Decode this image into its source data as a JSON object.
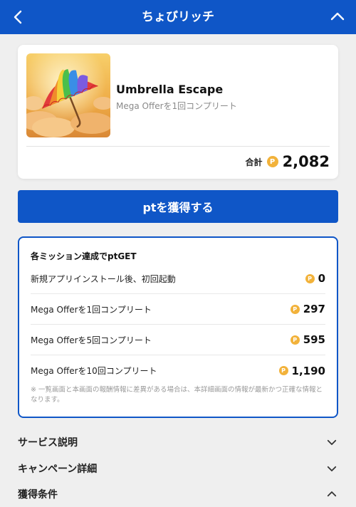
{
  "header": {
    "title": "ちょびリッチ",
    "back_icon": "chevron-left-icon",
    "collapse_icon": "chevron-up-icon"
  },
  "offer": {
    "name": "Umbrella Escape",
    "subtitle": "Mega Offerを1回コンプリート",
    "total_label": "合計",
    "total_value": "2,082"
  },
  "cta": {
    "label": "ptを獲得する"
  },
  "missions": {
    "title": "各ミッション達成でptGET",
    "items": [
      {
        "label": "新規アプリインストール後、初回起動",
        "points": "0"
      },
      {
        "label": "Mega Offerを1回コンプリート",
        "points": "297"
      },
      {
        "label": "Mega Offerを5回コンプリート",
        "points": "595"
      },
      {
        "label": "Mega Offerを10回コンプリート",
        "points": "1,190"
      }
    ],
    "note": "※ 一覧画面と本画面の報酬情報に差異がある場合は、本詳細画面の情報が最新かつ正確な情報となります。"
  },
  "sections": [
    {
      "label": "サービス説明",
      "icon": "chevron-down-icon"
    },
    {
      "label": "キャンペーン詳細",
      "icon": "chevron-down-icon"
    },
    {
      "label": "獲得条件",
      "icon": "chevron-up-icon"
    }
  ],
  "coin_glyph": "P",
  "colors": {
    "brand": "#0f56c7",
    "coin": "#f2b23a",
    "background": "#efefef"
  }
}
